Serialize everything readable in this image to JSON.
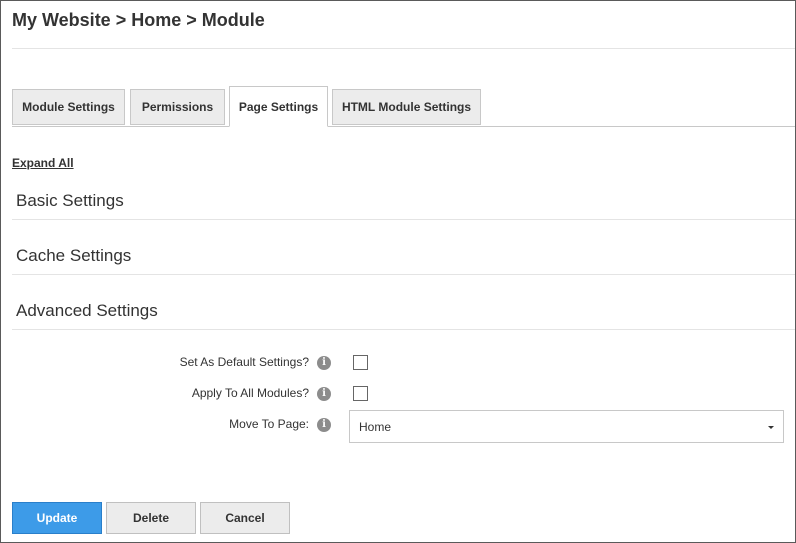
{
  "header": {
    "breadcrumb": "My Website > Home > Module"
  },
  "tabs": [
    {
      "label": "Module Settings",
      "active": false
    },
    {
      "label": "Permissions",
      "active": false
    },
    {
      "label": "Page Settings",
      "active": true
    },
    {
      "label": "HTML Module Settings",
      "active": false
    }
  ],
  "expand_all": "Expand All",
  "sections": [
    {
      "label": "Basic Settings"
    },
    {
      "label": "Cache Settings"
    },
    {
      "label": "Advanced Settings"
    }
  ],
  "fields": {
    "set_default": {
      "label": "Set As Default Settings?",
      "checked": false
    },
    "apply_all": {
      "label": "Apply To All Modules?",
      "checked": false
    },
    "move_to_page": {
      "label": "Move To Page:",
      "value": "Home"
    }
  },
  "info_icon_glyph": "i",
  "buttons": {
    "update": "Update",
    "delete": "Delete",
    "cancel": "Cancel"
  },
  "colors": {
    "primary_button": "#3d9be8",
    "tab_inactive": "#ececec"
  }
}
